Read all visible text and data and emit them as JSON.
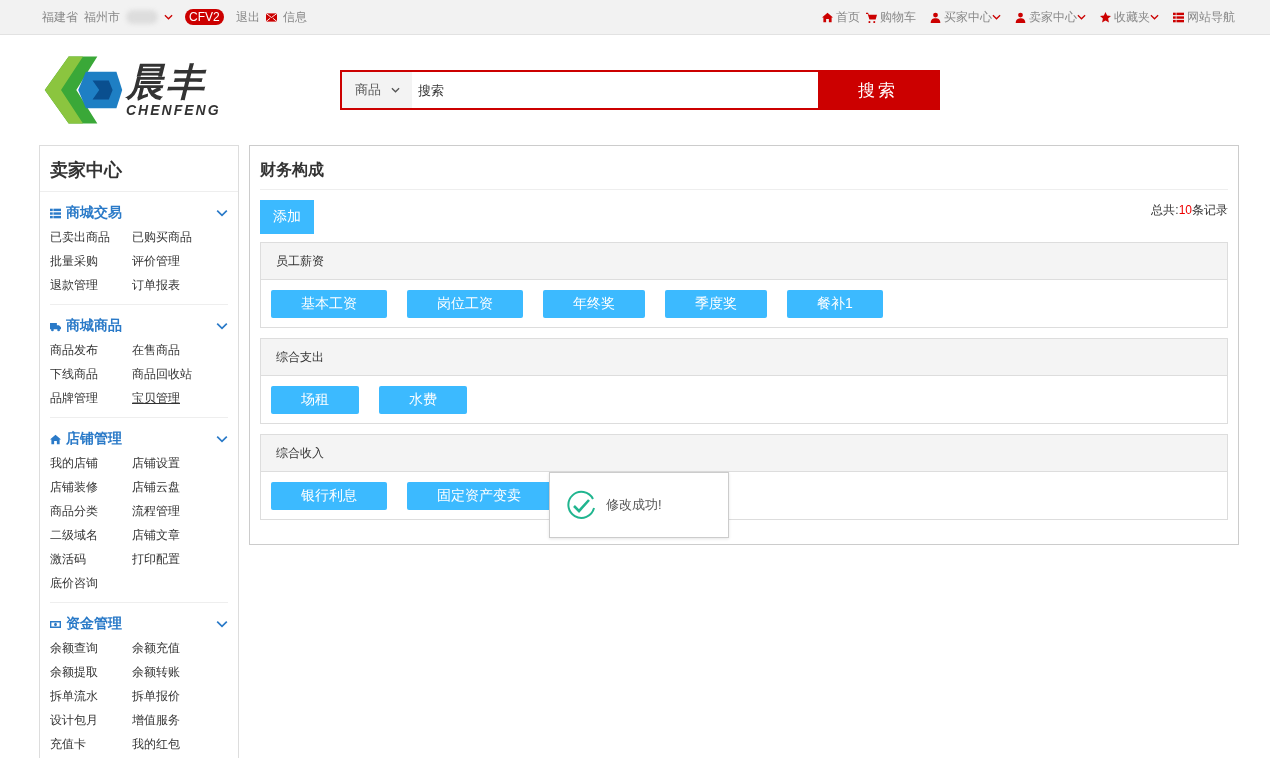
{
  "top_bar": {
    "location": {
      "province": "福建省",
      "city": "福州市"
    },
    "badge": "CFV2",
    "logout": "退出",
    "messages": "信息",
    "nav": [
      {
        "kind": "home",
        "label": "首页",
        "dropdown": false
      },
      {
        "kind": "cart",
        "label": "购物车",
        "dropdown": false
      },
      {
        "kind": "user",
        "label": "买家中心",
        "dropdown": true
      },
      {
        "kind": "user",
        "label": "卖家中心",
        "dropdown": true
      },
      {
        "kind": "star",
        "label": "收藏夹",
        "dropdown": true
      },
      {
        "kind": "list",
        "label": "网站导航",
        "dropdown": false
      }
    ]
  },
  "logo": {
    "name": "晨丰",
    "latin": "CHENFENG"
  },
  "search": {
    "category": "商品",
    "placeholder": "搜索",
    "button": "搜索"
  },
  "sidebar": {
    "title": "卖家中心",
    "sections": [
      {
        "kind": "list",
        "title": "商城交易",
        "expanded": true,
        "items": [
          {
            "label": "已卖出商品",
            "underlined": false
          },
          {
            "label": "已购买商品",
            "underlined": false
          },
          {
            "label": "批量采购",
            "underlined": false
          },
          {
            "label": "评价管理",
            "underlined": false
          },
          {
            "label": "退款管理",
            "underlined": false
          },
          {
            "label": "订单报表",
            "underlined": false
          }
        ]
      },
      {
        "kind": "truck",
        "title": "商城商品",
        "expanded": true,
        "items": [
          {
            "label": "商品发布",
            "underlined": false
          },
          {
            "label": "在售商品",
            "underlined": false
          },
          {
            "label": "下线商品",
            "underlined": false
          },
          {
            "label": "商品回收站",
            "underlined": false
          },
          {
            "label": "品牌管理",
            "underlined": false
          },
          {
            "label": "宝贝管理",
            "underlined": true
          }
        ]
      },
      {
        "kind": "home",
        "title": "店铺管理",
        "expanded": true,
        "items": [
          {
            "label": "我的店铺",
            "underlined": false
          },
          {
            "label": "店铺设置",
            "underlined": false
          },
          {
            "label": "店铺装修",
            "underlined": false
          },
          {
            "label": "店铺云盘",
            "underlined": false
          },
          {
            "label": "商品分类",
            "underlined": false
          },
          {
            "label": "流程管理",
            "underlined": false
          },
          {
            "label": "二级域名",
            "underlined": false
          },
          {
            "label": "店铺文章",
            "underlined": false
          },
          {
            "label": "激活码",
            "underlined": false
          },
          {
            "label": "打印配置",
            "underlined": false
          },
          {
            "label": "底价咨询",
            "underlined": false
          }
        ]
      },
      {
        "kind": "money",
        "title": "资金管理",
        "expanded": true,
        "items": [
          {
            "label": "余额查询",
            "underlined": false
          },
          {
            "label": "余额充值",
            "underlined": false
          },
          {
            "label": "余额提取",
            "underlined": false
          },
          {
            "label": "余额转账",
            "underlined": false
          },
          {
            "label": "拆单流水",
            "underlined": false
          },
          {
            "label": "拆单报价",
            "underlined": false
          },
          {
            "label": "设计包月",
            "underlined": false
          },
          {
            "label": "增值服务",
            "underlined": false
          },
          {
            "label": "充值卡",
            "underlined": false
          },
          {
            "label": "我的红包",
            "underlined": false
          }
        ]
      }
    ]
  },
  "content": {
    "title": "财务构成",
    "add_button": "添加",
    "total": {
      "prefix": "总共:",
      "count": "10",
      "suffix": "条记录"
    },
    "groups": [
      {
        "title": "员工薪资",
        "items": [
          "基本工资",
          "岗位工资",
          "年终奖",
          "季度奖",
          "餐补1"
        ]
      },
      {
        "title": "综合支出",
        "items": [
          "场租",
          "水费"
        ]
      },
      {
        "title": "综合收入",
        "items": [
          "银行利息",
          "固定资产变卖"
        ]
      }
    ]
  },
  "toast": {
    "kind": "success",
    "message": "修改成功!"
  }
}
